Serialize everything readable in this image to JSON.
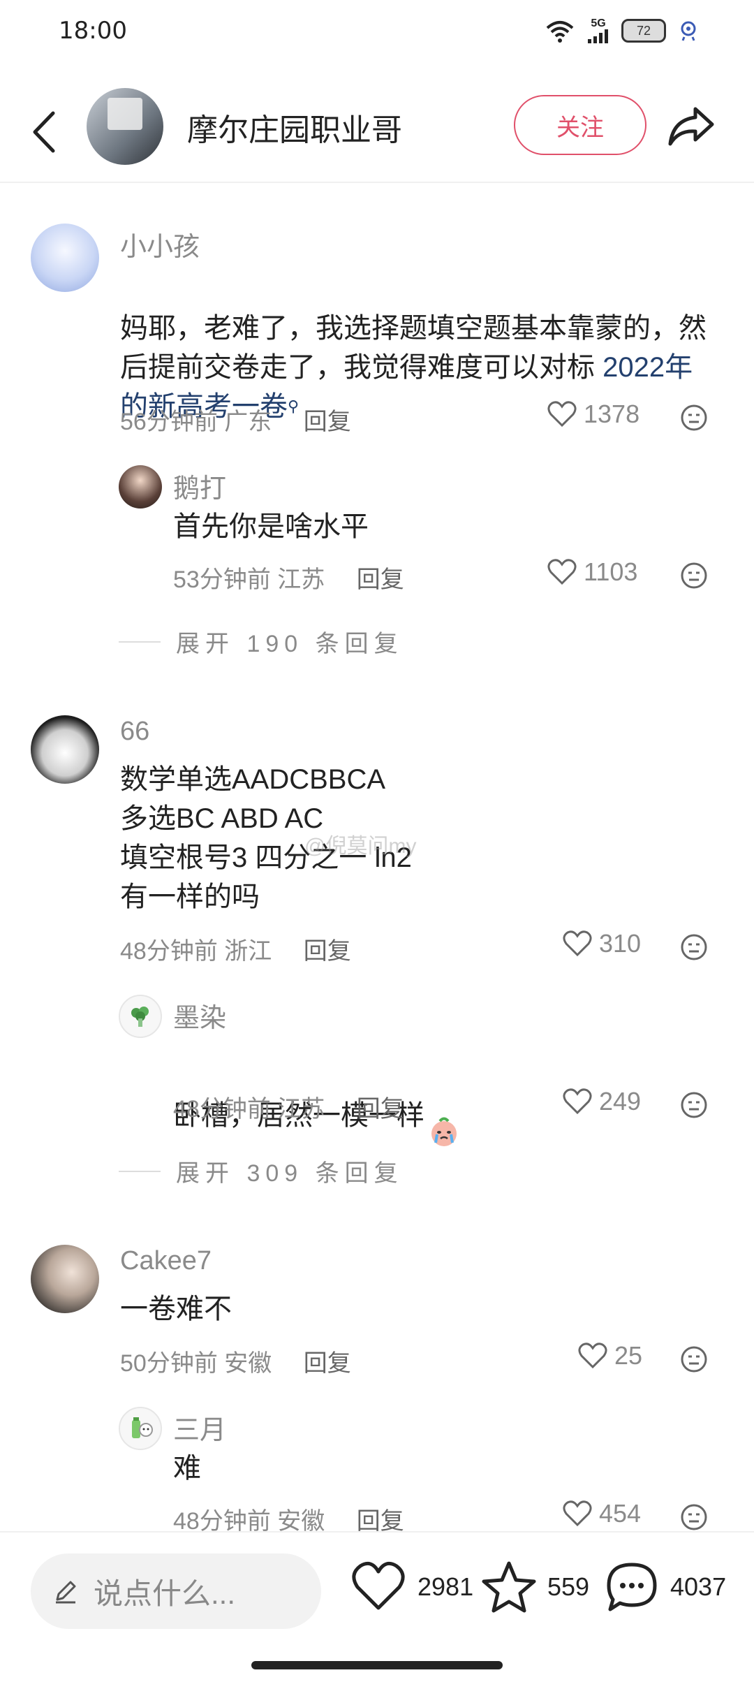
{
  "status_bar": {
    "time": "18:00",
    "network": "5G",
    "battery": "72",
    "icons": [
      "wifi-icon",
      "signal-icon",
      "battery-icon",
      "app-icon"
    ]
  },
  "header": {
    "title": "摩尔庄园职业哥",
    "follow_label": "关注",
    "icons": [
      "back-icon",
      "share-icon"
    ]
  },
  "comments": [
    {
      "name": "小小孩",
      "text": "妈耶，老难了，我选择题填空题基本靠蒙的，然后提前交卷走了，我觉得难度可以对标 ",
      "link": "2022年的新高考一卷",
      "time": "56分钟前",
      "location": "广东",
      "reply_label": "回复",
      "likes": "1378",
      "replies": [
        {
          "name": "鹅打",
          "text": "首先你是啥水平",
          "time": "53分钟前",
          "location": "江苏",
          "reply_label": "回复",
          "likes": "1103"
        }
      ],
      "expand": "展开 190 条回复"
    },
    {
      "name": "66",
      "text": "数学单选AADCBBCA\n多选BC  ABD  AC\n填空根号3  四分之一   ln2\n有一样的吗",
      "time": "48分钟前",
      "location": "浙江",
      "reply_label": "回复",
      "likes": "310",
      "replies": [
        {
          "name": "墨染",
          "text": "卧槽，居然一模一样",
          "time": "48分钟前",
          "location": "江苏",
          "reply_label": "回复",
          "likes": "249"
        }
      ],
      "expand": "展开 309 条回复"
    },
    {
      "name": "Cakee7",
      "text": "一卷难不",
      "time": "50分钟前",
      "location": "安徽",
      "reply_label": "回复",
      "likes": "25",
      "replies": [
        {
          "name": "三月",
          "text": "难",
          "time": "48分钟前",
          "location": "安徽",
          "reply_label": "回复",
          "likes": "454"
        }
      ]
    }
  ],
  "watermark": "@倪莫问my",
  "bottom_bar": {
    "input_placeholder": "说点什么...",
    "likes": "2981",
    "favorites": "559",
    "comments": "4037"
  },
  "colors": {
    "accent": "#e0506a",
    "link": "#23406e",
    "meta": "#8a8a8a"
  }
}
